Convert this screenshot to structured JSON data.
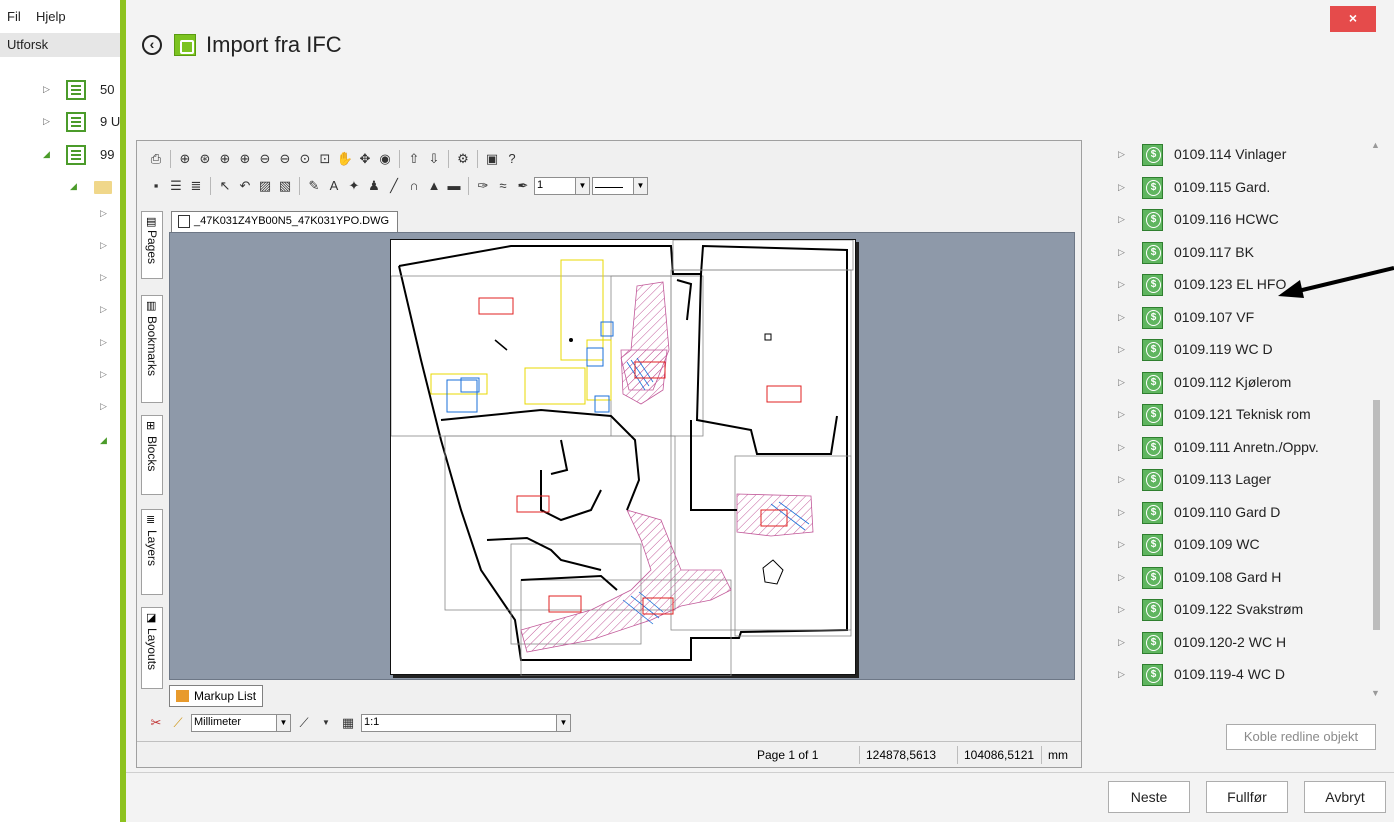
{
  "background_app": {
    "menu": [
      "Fil",
      "Hjelp"
    ],
    "explore_tab": "Utforsk",
    "tree": [
      {
        "text": "50"
      },
      {
        "text": "9 U"
      },
      {
        "text": "99"
      }
    ]
  },
  "dialog": {
    "title": "Import fra IFC",
    "close_label": "×"
  },
  "viewer": {
    "document_tab": "_47K031Z4YB00N5_47K031YPO.DWG",
    "side_tabs": [
      "Pages",
      "Bookmarks",
      "Blocks",
      "Layers",
      "Layouts"
    ],
    "lineweight_value": "1",
    "markup_tab": "Markup List",
    "unit_select": "Millimeter",
    "scale_value": "1:1",
    "status": {
      "page": "Page 1 of 1",
      "x": "124878,5613",
      "y": "104086,5121",
      "unit": "mm"
    }
  },
  "rooms": [
    "0109.114 Vinlager",
    "0109.115 Gard.",
    "0109.116 HCWC",
    "0109.117 BK",
    "0109.123 EL HFO",
    "0109.107 VF",
    "0109.119 WC D",
    "0109.112 Kjølerom",
    "0109.121 Teknisk rom",
    "0109.111 Anretn./Oppv.",
    "0109.113 Lager",
    "0109.110 Gard D",
    "0109.109 WC",
    "0109.108 Gard H",
    "0109.122 Svakstrøm",
    "0109.120-2 WC H",
    "0109.119-4 WC D"
  ],
  "buttons": {
    "redline": "Koble redline objekt",
    "next": "Neste",
    "finish": "Fullfør",
    "cancel": "Avbryt"
  },
  "colors": {
    "accent": "#8dc21f",
    "close": "#e54b4b",
    "drawing_bg": "#8e99a9"
  }
}
